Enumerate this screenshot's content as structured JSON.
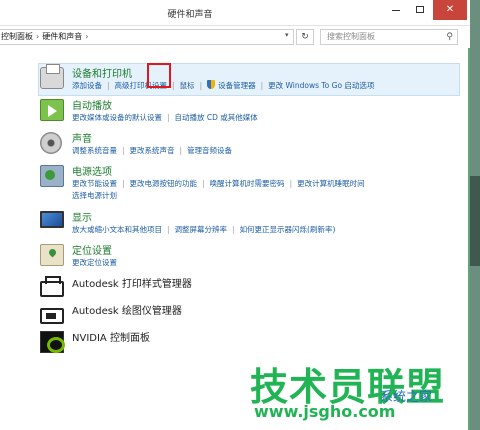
{
  "window": {
    "title": "硬件和声音"
  },
  "address": {
    "crumb_1": "控制面板",
    "crumb_2": "硬件和声音",
    "search_placeholder": "搜索控制面板"
  },
  "categories": [
    {
      "title": "设备和打印机",
      "links": [
        "添加设备",
        "高级打印机设置",
        "鼠标",
        "设备管理器",
        "更改 Windows To Go 启动选项"
      ]
    },
    {
      "title": "自动播放",
      "links": [
        "更改媒体或设备的默认设置",
        "自动播放 CD 或其他媒体"
      ]
    },
    {
      "title": "声音",
      "links": [
        "调整系统音量",
        "更改系统声音",
        "管理音频设备"
      ]
    },
    {
      "title": "电源选项",
      "links": [
        "更改节能设置",
        "更改电源按钮的功能",
        "唤醒计算机时需要密码",
        "更改计算机睡眠时间"
      ],
      "links2": [
        "选择电源计划"
      ]
    },
    {
      "title": "显示",
      "links": [
        "放大或缩小文本和其他项目",
        "调整屏幕分辨率",
        "如何更正显示器闪烁(刷新率)"
      ]
    },
    {
      "title": "定位设置",
      "links": [
        "更改定位设置"
      ]
    }
  ],
  "drivers": [
    {
      "label": "Autodesk 打印样式管理器"
    },
    {
      "label": "Autodesk 绘图仪管理器"
    },
    {
      "label": "NVIDIA 控制面板"
    }
  ],
  "watermark": {
    "big": "技术员联盟",
    "site": "www.jsgho.com",
    "tag": "系统之家"
  },
  "colors": {
    "category_title": "#1e7d2f",
    "link": "#1e5ea8",
    "highlight_bg": "#e5f1fb",
    "red_box": "#e1171c",
    "close_button": "#c7453a"
  }
}
